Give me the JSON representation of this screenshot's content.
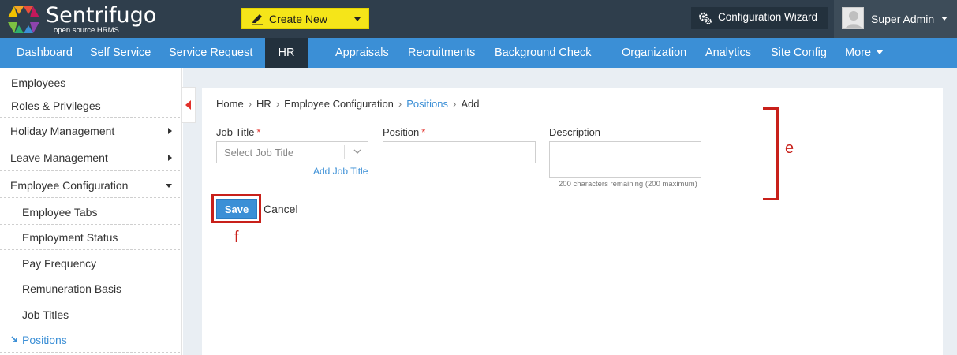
{
  "brand": {
    "name": "Sentrifugo",
    "tagline": "open source HRMS"
  },
  "topbar": {
    "create_new_label": "Create New",
    "config_wizard_label": "Configuration Wizard",
    "user_name": "Super Admin"
  },
  "nav": {
    "items": [
      "Dashboard",
      "Self Service",
      "Service Request",
      "HR",
      "Appraisals",
      "Recruitments",
      "Background Check",
      "Organization",
      "Analytics",
      "Site Config",
      "More"
    ],
    "active": "HR"
  },
  "sidebar": {
    "items": [
      "Employees",
      "Roles & Privileges",
      "Holiday Management",
      "Leave Management",
      "Employee Configuration"
    ],
    "subitems": [
      "Employee Tabs",
      "Employment Status",
      "Pay Frequency",
      "Remuneration Basis",
      "Job Titles",
      "Positions"
    ],
    "current": "Positions"
  },
  "breadcrumb": [
    "Home",
    "HR",
    "Employee Configuration",
    "Positions",
    "Add"
  ],
  "form": {
    "job_title_label": "Job Title",
    "job_title_placeholder": "Select Job Title",
    "add_job_title_label": "Add Job Title",
    "position_label": "Position",
    "position_value": "",
    "description_label": "Description",
    "description_value": "",
    "description_note": "200 characters remaining (200 maximum)",
    "required_marker": "*",
    "save_label": "Save",
    "cancel_label": "Cancel"
  },
  "annotations": {
    "e": "e",
    "f": "f"
  },
  "colors": {
    "topbar": "#2f3e4c",
    "nav": "#3b8fd6",
    "create_new": "#f5e519",
    "annotation": "#c8201a",
    "link": "#3b8fd6"
  }
}
